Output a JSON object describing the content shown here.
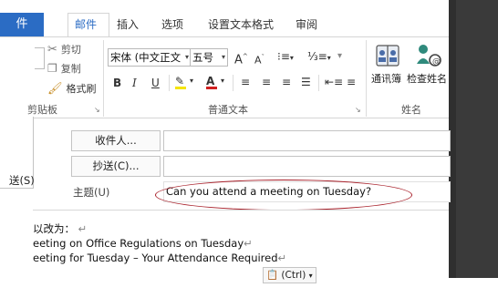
{
  "tabs": {
    "file": "件",
    "mail": "邮件",
    "insert": "插入",
    "options": "选项",
    "format_text": "设置文本格式",
    "review": "审阅"
  },
  "clipboard": {
    "cut": "剪切",
    "copy": "复制",
    "format_painter": "格式刷",
    "group_label": "剪贴板"
  },
  "basic_text": {
    "font_name": "宋体 (中文正文",
    "font_size": "五号",
    "group_label": "普通文本"
  },
  "names": {
    "address_book": "通讯簿",
    "check_names": "检查姓名",
    "group_label": "姓名"
  },
  "header": {
    "to_button": "收件人...",
    "cc_button": "抄送(C)...",
    "subject_label": "主题(U)",
    "send_label": "送(S)",
    "subject_value": "Can you attend a meeting on Tuesday?"
  },
  "body": {
    "line1": "以改为：",
    "line2": "eeting on Office Regulations on Tuesday",
    "line3": "eeting for Tuesday – Your Attendance Required",
    "paste_options": "(Ctrl)"
  },
  "colors": {
    "accent": "#2b6cc4",
    "ellipse": "#a8202a",
    "dark_panel": "#2f2f2f"
  }
}
